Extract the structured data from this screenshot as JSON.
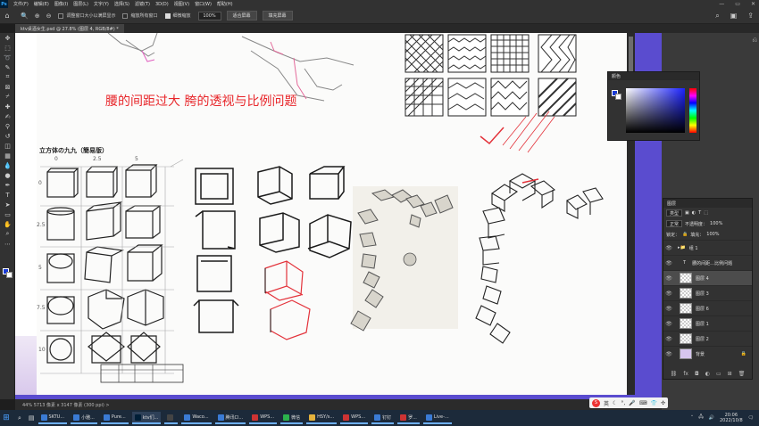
{
  "menubar": {
    "logo": "Ps",
    "items": [
      "文件(F)",
      "编辑(E)",
      "图像(I)",
      "图层(L)",
      "文字(Y)",
      "选择(S)",
      "滤镜(T)",
      "3D(D)",
      "视图(V)",
      "窗口(W)",
      "帮助(H)"
    ]
  },
  "options": {
    "resize_label": "调整窗口大小以满屏显示",
    "zoom_all_label": "缩放所有窗口",
    "scrubby_label": "细微缩放",
    "zoom_value": "100%",
    "fit_label": "适合屏幕",
    "fill_label": "填充屏幕"
  },
  "document_tab": "ktv桌酒女生.psd @ 27.8% (图层 4, RGB/8#) *",
  "canvas": {
    "red_title": "腰的间距过大  胯的透视与比例问题",
    "cube_title": "立方体の九九（簡易版）",
    "column_labels": [
      "0",
      "2.5",
      "5"
    ],
    "row_labels": [
      "0",
      "2.5",
      "5",
      "7.5",
      "10"
    ]
  },
  "status_text": "44%   5713 像素 x 3147 像素 (300 ppi)   >",
  "color_panel": {
    "title": "颜色"
  },
  "layers_panel": {
    "title": "图层",
    "kind_label": "类型",
    "blend_mode": "正常",
    "opacity_label": "不透明度：",
    "opacity_value": "100%",
    "lock_label": "锁定：",
    "fill_label": "填充：",
    "fill_value": "100%",
    "group_name": "组 1",
    "layers": [
      {
        "name": "腰的间距…比例问题",
        "type": "text"
      },
      {
        "name": "图层 4",
        "type": "pixel",
        "active": true
      },
      {
        "name": "图层 3",
        "type": "pixel"
      },
      {
        "name": "图层 6",
        "type": "pixel"
      },
      {
        "name": "图层 1",
        "type": "pixel"
      },
      {
        "name": "图层 2",
        "type": "pixel"
      },
      {
        "name": "背景",
        "type": "background"
      }
    ]
  },
  "ime": {
    "label": "英"
  },
  "taskbar": {
    "items": [
      "SKTU...",
      "小雅...",
      "Pure...",
      "ktv们...",
      "",
      "Waco...",
      "腾讯Cl...",
      "WPS...",
      "微信",
      "HSY/s...",
      "WPS...",
      "钉钉",
      "罗...",
      "Live-..."
    ],
    "time": "20:06",
    "date": "2022/10/8"
  }
}
